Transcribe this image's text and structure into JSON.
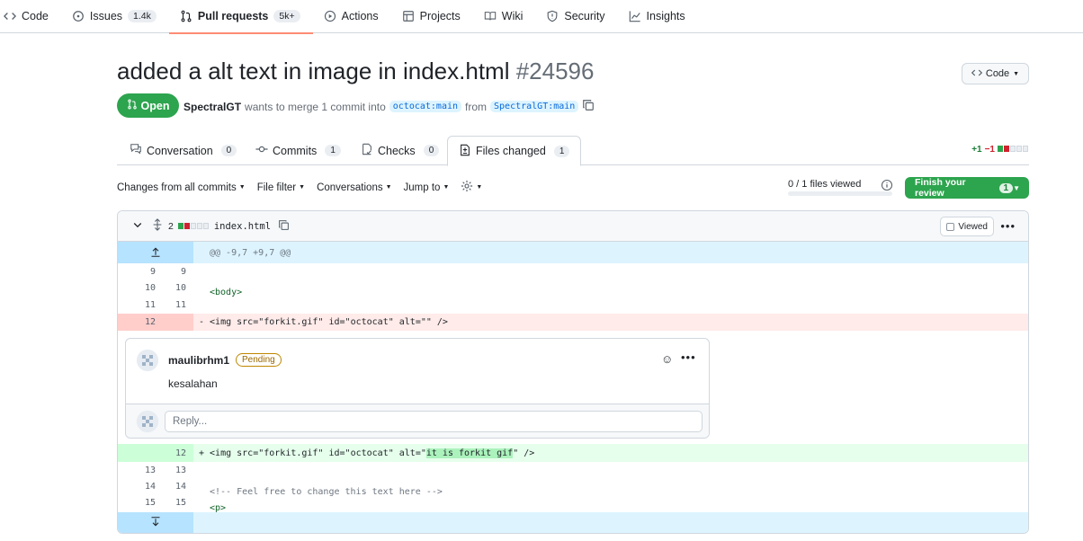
{
  "nav": {
    "items": [
      {
        "label": "Code",
        "icon": "code-icon"
      },
      {
        "label": "Issues",
        "icon": "issue-icon",
        "count": "1.4k"
      },
      {
        "label": "Pull requests",
        "icon": "git-pull-request-icon",
        "count": "5k+"
      },
      {
        "label": "Actions",
        "icon": "play-icon"
      },
      {
        "label": "Projects",
        "icon": "table-icon"
      },
      {
        "label": "Wiki",
        "icon": "book-icon"
      },
      {
        "label": "Security",
        "icon": "shield-icon"
      },
      {
        "label": "Insights",
        "icon": "graph-icon"
      }
    ]
  },
  "pr": {
    "title": "added a alt text in image in index.html",
    "number": "#24596",
    "state": "Open",
    "author": "SpectralGT",
    "merge_text": "wants to merge 1 commit into",
    "base": "octocat:main",
    "from_text": "from",
    "head": "SpectralGT:main",
    "code_button": "Code"
  },
  "tabs": [
    {
      "label": "Conversation",
      "count": "0",
      "icon": "comment-discussion-icon"
    },
    {
      "label": "Commits",
      "count": "1",
      "icon": "git-commit-icon"
    },
    {
      "label": "Checks",
      "count": "0",
      "icon": "checklist-icon"
    },
    {
      "label": "Files changed",
      "count": "1",
      "icon": "file-diff-icon"
    }
  ],
  "diffstat": {
    "additions": "+1",
    "deletions": "−1"
  },
  "toolbar": {
    "changes_from": "Changes from",
    "all_commits": "all commits",
    "file_filter": "File filter",
    "conversations": "Conversations",
    "jump_to": "Jump to",
    "files_viewed": "0 / 1 files viewed",
    "files_viewed_fraction": 0,
    "finish_review": "Finish your review",
    "finish_count": "1"
  },
  "file": {
    "changes": "2",
    "name": "index.html",
    "viewed_label": "Viewed",
    "hunk_header": "@@ -9,7 +9,7 @@",
    "lines": [
      {
        "old": "9",
        "new": "9",
        "text": ""
      },
      {
        "old": "10",
        "new": "10",
        "text": "<body>"
      },
      {
        "old": "11",
        "new": "11",
        "text": ""
      },
      {
        "old": "12",
        "new": "",
        "text": "- <img src=\"forkit.gif\" id=\"octocat\" alt=\"\" />"
      },
      {
        "old": "",
        "new": "12",
        "text": "+ <img src=\"forkit.gif\" id=\"octocat\" alt=\"it is forkit gif\" />"
      },
      {
        "old": "13",
        "new": "13",
        "text": ""
      },
      {
        "old": "14",
        "new": "14",
        "text": "<!-- Feel free to change this text here -->"
      },
      {
        "old": "15",
        "new": "15",
        "text": "<p>"
      }
    ]
  },
  "comment": {
    "author": "maulibrhm1",
    "status": "Pending",
    "body": "kesalahan",
    "reply_placeholder": "Reply..."
  }
}
